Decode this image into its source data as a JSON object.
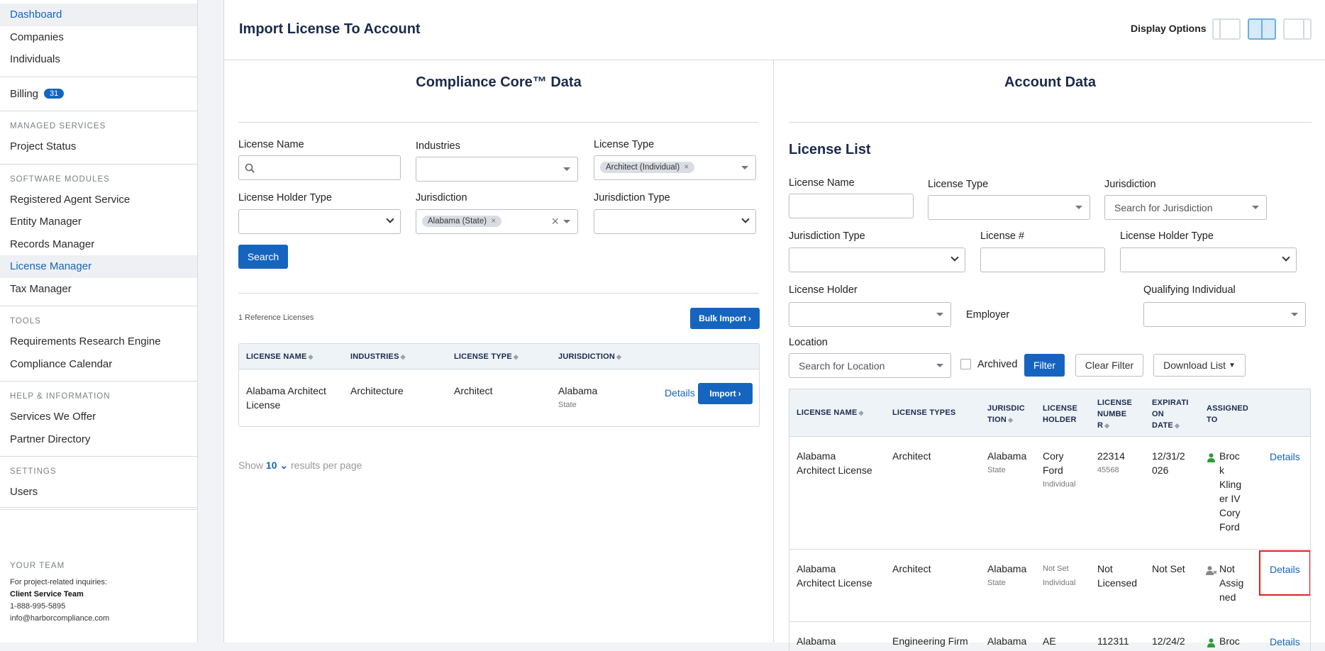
{
  "sidebar": {
    "top_items": [
      "Dashboard",
      "Companies",
      "Individuals"
    ],
    "billing": {
      "label": "Billing",
      "count": "31"
    },
    "managed_head": "MANAGED SERVICES",
    "managed_items": [
      "Project Status"
    ],
    "software_head": "SOFTWARE MODULES",
    "software_items": [
      "Registered Agent Service",
      "Entity Manager",
      "Records Manager",
      "License Manager",
      "Tax Manager"
    ],
    "tools_head": "TOOLS",
    "tools_items": [
      "Requirements Research Engine",
      "Compliance Calendar"
    ],
    "help_head": "HELP & INFORMATION",
    "help_items": [
      "Services We Offer",
      "Partner Directory"
    ],
    "settings_head": "SETTINGS",
    "settings_items": [
      "Users"
    ],
    "team": {
      "head": "YOUR TEAM",
      "note": "For project-related inquiries:",
      "name": "Client Service Team",
      "phone": "1-888-995-5895",
      "email": "info@harborcompliance.com"
    }
  },
  "header": {
    "title": "Import License To Account",
    "display_options": "Display Options"
  },
  "left": {
    "title": "Compliance Core™ Data",
    "labels": {
      "license_name": "License Name",
      "industries": "Industries",
      "license_type": "License Type",
      "holder_type": "License Holder Type",
      "jurisdiction": "Jurisdiction",
      "jurisdiction_type": "Jurisdiction Type"
    },
    "license_type_chip": "Architect (Individual)",
    "jurisdiction_chip": "Alabama (State)",
    "search_btn": "Search",
    "count": "1 Reference Licenses",
    "bulk_btn": "Bulk Import",
    "columns": [
      "LICENSE NAME",
      "INDUSTRIES",
      "LICENSE TYPE",
      "JURISDICTION"
    ],
    "row": {
      "name": "Alabama Architect License",
      "industry": "Architecture",
      "type": "Architect",
      "jurisdiction": "Alabama",
      "jur_sub": "State",
      "details": "Details",
      "import": "Import"
    },
    "show": "Show",
    "per_page": "10",
    "results": "results per page"
  },
  "right": {
    "title": "Account Data",
    "list_title": "License List",
    "labels": {
      "license_name": "License Name",
      "license_type": "License Type",
      "jurisdiction": "Jurisdiction",
      "jurisdiction_type": "Jurisdiction Type",
      "license_num": "License #",
      "holder_type": "License Holder Type",
      "holder": "License Holder",
      "employer": "Employer",
      "qualifying": "Qualifying Individual",
      "location": "Location"
    },
    "jur_placeholder": "Search for Jurisdiction",
    "loc_placeholder": "Search for Location",
    "archived": "Archived",
    "filter_btn": "Filter",
    "clear_btn": "Clear Filter",
    "download_btn": "Download List",
    "columns": {
      "c1": "LICENSE NAME",
      "c2": "LICENSE TYPES",
      "c3a": "JURISDIC",
      "c3b": "TION",
      "c4a": "LICENSE",
      "c4b": "HOLDER",
      "c5a": "LICENSE",
      "c5b": "NUMBE",
      "c5c": "R",
      "c6a": "EXPIRATI",
      "c6b": "ON",
      "c6c": "DATE",
      "c7a": "ASSIGNED",
      "c7b": "TO"
    },
    "rows": [
      {
        "name1": "Alabama",
        "name2": "Architect License",
        "type": "Architect",
        "jur": "Alabama",
        "jur_sub": "State",
        "holder1": "Cory",
        "holder2": "Ford",
        "holder_sub": "Individual",
        "num": "22314",
        "num_sub": "45568",
        "exp1": "12/31/2",
        "exp2": "026",
        "assigned": [
          "Broc",
          "k",
          "Kling",
          "er IV",
          "Cory",
          "Ford"
        ],
        "details": "Details"
      },
      {
        "name1": "Alabama",
        "name2": "Architect License",
        "type": "Architect",
        "jur": "Alabama",
        "jur_sub": "State",
        "holder1": "Not Set",
        "holder_sub": "Individual",
        "num1": "Not",
        "num2": "Licensed",
        "exp": "Not Set",
        "assigned": [
          "Not",
          "Assig",
          "ned"
        ],
        "details": "Details"
      },
      {
        "name1": "Alabama",
        "type": "Engineering Firm",
        "jur": "Alabama",
        "holder1": "AE",
        "num": "112311",
        "exp": "12/24/2",
        "assigned": [
          "Broc"
        ],
        "details": "Details"
      }
    ]
  },
  "colors": {
    "accent": "#1565c0",
    "highlight": "#e02020"
  }
}
